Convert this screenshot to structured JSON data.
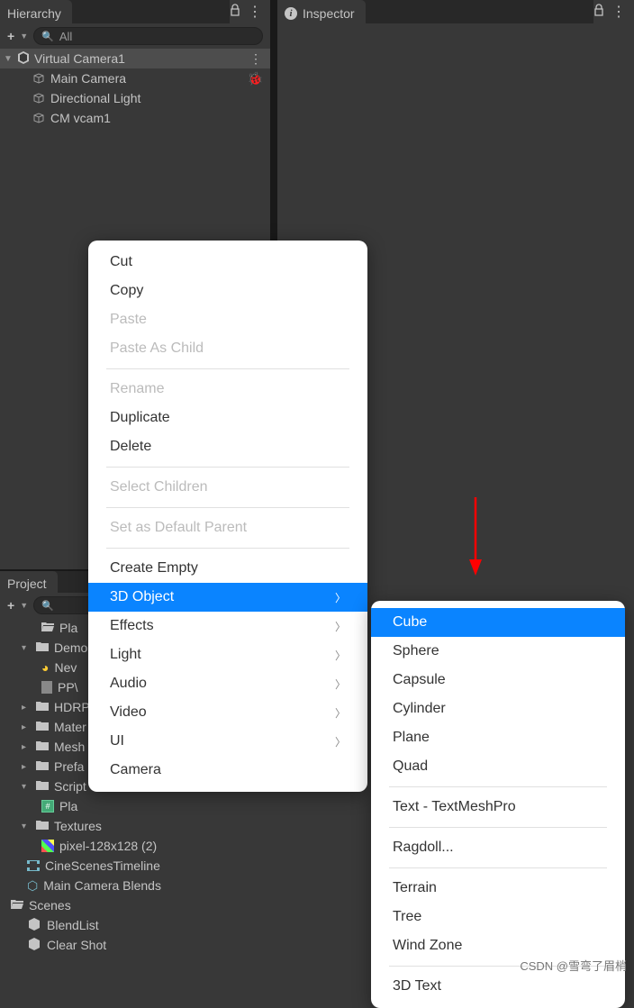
{
  "hierarchy": {
    "tab": "Hierarchy",
    "search": "All",
    "scene": "Virtual Camera1",
    "children": [
      "Main Camera",
      "Directional Light",
      "CM vcam1"
    ]
  },
  "inspector": {
    "tab": "Inspector"
  },
  "project": {
    "tab": "Project",
    "items": [
      {
        "t": "folder-open",
        "label": "Pla",
        "indent": 36
      },
      {
        "t": "folder",
        "label": "Demo",
        "indent": 14,
        "fold": "▾"
      },
      {
        "t": "shape",
        "label": "Nev",
        "indent": 36
      },
      {
        "t": "file",
        "label": "PP\\",
        "indent": 36
      },
      {
        "t": "folder",
        "label": "HDRP",
        "indent": 14,
        "fold": "▸"
      },
      {
        "t": "folder",
        "label": "Mater",
        "indent": 14,
        "fold": "▸"
      },
      {
        "t": "folder",
        "label": "Mesh",
        "indent": 14,
        "fold": "▸"
      },
      {
        "t": "folder",
        "label": "Prefa",
        "indent": 14,
        "fold": "▸"
      },
      {
        "t": "folder",
        "label": "Script",
        "indent": 14,
        "fold": "▾"
      },
      {
        "t": "script",
        "label": "Pla",
        "indent": 36
      },
      {
        "t": "folder",
        "label": "Textures",
        "indent": 14,
        "fold": "▾"
      },
      {
        "t": "pixel",
        "label": "pixel-128x128 (2)",
        "indent": 36
      },
      {
        "t": "film",
        "label": "CineScenesTimeline",
        "indent": 20
      },
      {
        "t": "hex",
        "label": "Main Camera Blends",
        "indent": 20
      },
      {
        "t": "folder-open",
        "label": "Scenes",
        "indent": 2
      },
      {
        "t": "unity",
        "label": "BlendList",
        "indent": 20
      },
      {
        "t": "unity",
        "label": "Clear Shot",
        "indent": 20
      }
    ]
  },
  "contextMenu": {
    "items": [
      {
        "label": "Cut"
      },
      {
        "label": "Copy"
      },
      {
        "label": "Paste",
        "disabled": true
      },
      {
        "label": "Paste As Child",
        "disabled": true
      },
      {
        "sep": true
      },
      {
        "label": "Rename",
        "disabled": true
      },
      {
        "label": "Duplicate"
      },
      {
        "label": "Delete"
      },
      {
        "sep": true
      },
      {
        "label": "Select Children",
        "disabled": true
      },
      {
        "sep": true
      },
      {
        "label": "Set as Default Parent",
        "disabled": true
      },
      {
        "sep": true
      },
      {
        "label": "Create Empty"
      },
      {
        "label": "3D Object",
        "sub": true,
        "hi": true
      },
      {
        "label": "Effects",
        "sub": true
      },
      {
        "label": "Light",
        "sub": true
      },
      {
        "label": "Audio",
        "sub": true
      },
      {
        "label": "Video",
        "sub": true
      },
      {
        "label": "UI",
        "sub": true
      },
      {
        "label": "Camera"
      }
    ]
  },
  "subMenu": {
    "items": [
      {
        "label": "Cube",
        "hi": true
      },
      {
        "label": "Sphere"
      },
      {
        "label": "Capsule"
      },
      {
        "label": "Cylinder"
      },
      {
        "label": "Plane"
      },
      {
        "label": "Quad"
      },
      {
        "sep": true
      },
      {
        "label": "Text - TextMeshPro"
      },
      {
        "sep": true
      },
      {
        "label": "Ragdoll..."
      },
      {
        "sep": true
      },
      {
        "label": "Terrain"
      },
      {
        "label": "Tree"
      },
      {
        "label": "Wind Zone"
      },
      {
        "sep": true
      },
      {
        "label": "3D Text"
      }
    ]
  },
  "watermark": "CSDN @雪弯了眉梢"
}
